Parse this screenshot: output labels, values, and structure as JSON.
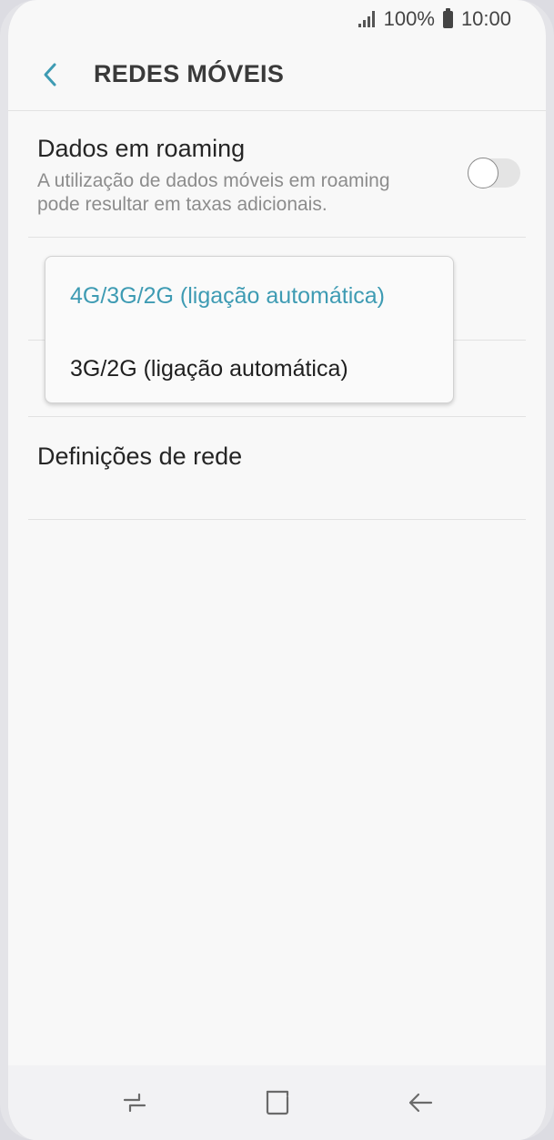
{
  "status_bar": {
    "battery": "100%",
    "time": "10:00"
  },
  "header": {
    "title": "REDES MÓVEIS"
  },
  "roaming": {
    "title": "Dados em roaming",
    "description": "A utilização de dados móveis em roaming pode resultar em taxas adicionais.",
    "enabled": false
  },
  "network_mode_popup": {
    "options": [
      {
        "label": "4G/3G/2G (ligação automática)",
        "selected": true
      },
      {
        "label": "3G/2G (ligação automática)",
        "selected": false
      }
    ]
  },
  "settings": {
    "network_settings_label": "Definições de rede"
  },
  "colors": {
    "accent": "#3e9bb3",
    "background": "#f8f8f8"
  },
  "icons": {
    "back": "chevron-left-icon",
    "recents": "recent-apps-icon",
    "home": "home-square-icon",
    "nav_back": "arrow-left-icon"
  }
}
